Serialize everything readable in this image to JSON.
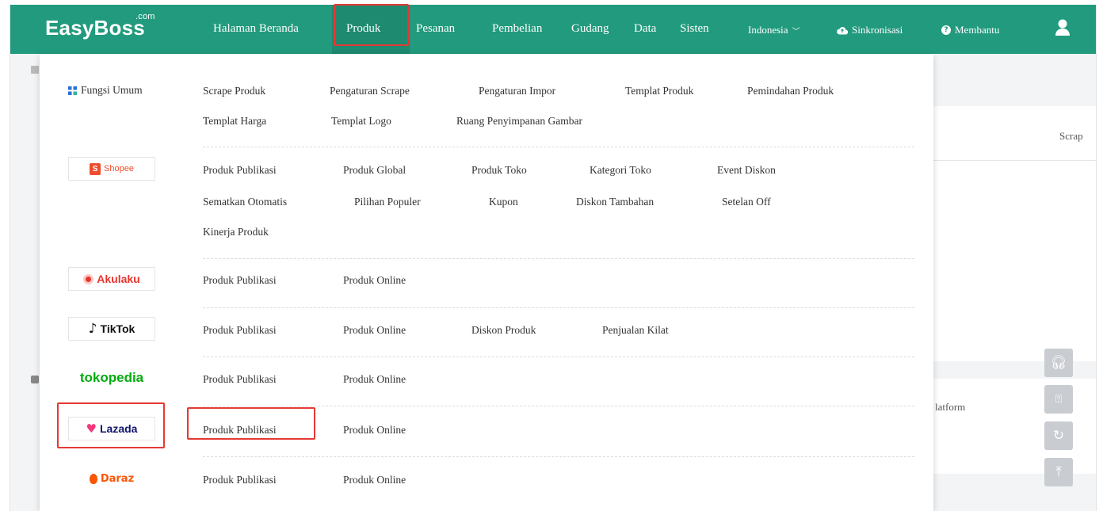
{
  "brand": {
    "logo": "EasyBoss",
    "logo_sup": ".com"
  },
  "nav": {
    "items": [
      "Halaman Beranda",
      "Produk",
      "Pesanan",
      "Pembelian",
      "Gudang",
      "Data",
      "Sisten"
    ],
    "active": "Produk"
  },
  "header_right": {
    "language": "Indonesia",
    "sync": "Sinkronisasi",
    "help": "Membantu"
  },
  "background": {
    "scrap_text": "Scrap",
    "platform_text": "latform"
  },
  "dropdown": {
    "general": {
      "label": "Fungsi Umum",
      "links": [
        "Scrape Produk",
        "Pengaturan Scrape",
        "Pengaturan Impor",
        "Templat Produk",
        "Pemindahan Produk",
        "Templat Harga",
        "Templat Logo",
        "Ruang Penyimpanan Gambar"
      ]
    },
    "shopee": {
      "label": "Shopee",
      "links": [
        "Produk Publikasi",
        "Produk Global",
        "Produk Toko",
        "Kategori Toko",
        "Event Diskon",
        "Sematkan Otomatis",
        "Pilihan Populer",
        "Kupon",
        "Diskon Tambahan",
        "Setelan Off",
        "Kinerja Produk"
      ]
    },
    "akulaku": {
      "label": "Akulaku",
      "links": [
        "Produk Publikasi",
        "Produk Online"
      ]
    },
    "tiktok": {
      "label": "TikTok",
      "links": [
        "Produk Publikasi",
        "Produk Online",
        "Diskon Produk",
        "Penjualan Kilat"
      ]
    },
    "tokopedia": {
      "label": "tokopedia",
      "links": [
        "Produk Publikasi",
        "Produk Online"
      ]
    },
    "lazada": {
      "label": "Lazada",
      "links": [
        "Produk Publikasi",
        "Produk Online"
      ]
    },
    "daraz": {
      "label": "Daraz",
      "links": [
        "Produk Publikasi",
        "Produk Online"
      ]
    }
  },
  "colors": {
    "header_green": "#229a7d",
    "highlight_red": "#e53935",
    "shopee_orange": "#ee4d2d",
    "akulaku_red": "#e8342d",
    "tokopedia_green": "#03ac0e",
    "lazada_blue": "#0f146d",
    "daraz_orange": "#f85606"
  }
}
